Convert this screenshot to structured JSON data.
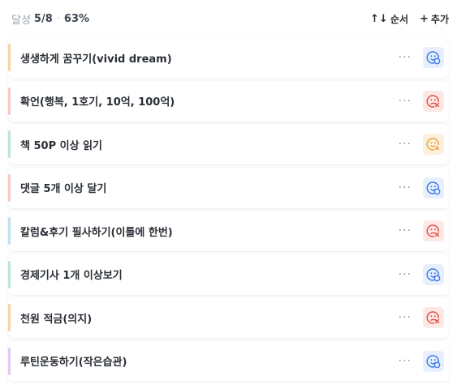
{
  "header": {
    "progress_label": "달성",
    "progress_count": "5/8",
    "progress_separator": "·",
    "progress_percent": "63%",
    "sort_icon": "↑↓",
    "sort_label": "순서",
    "add_icon": "+",
    "add_label": "추가"
  },
  "habits": [
    {
      "title": "생생하게 꿈꾸기(vivid dream)",
      "bar": "#f4d6a3",
      "status": "done",
      "more": "···"
    },
    {
      "title": "확언(행복, 1호기, 10억, 100억)",
      "bar": "#f6c9c3",
      "status": "failed",
      "more": "···"
    },
    {
      "title": "책 50P 이상 읽기",
      "bar": "#bfe3e0",
      "status": "partial",
      "more": "···"
    },
    {
      "title": "댓글 5개 이상 달기",
      "bar": "#f6c9c3",
      "status": "done",
      "more": "···"
    },
    {
      "title": "칼럼&후기 필사하기(이틀에 한번)",
      "bar": "#c3dff0",
      "status": "failed",
      "more": "···"
    },
    {
      "title": "경제기사 1개 이상보기",
      "bar": "#bfe3e0",
      "status": "done",
      "more": "···"
    },
    {
      "title": "천원 적금(의지)",
      "bar": "#f4d6a3",
      "status": "failed",
      "more": "···"
    },
    {
      "title": "루틴운동하기(작은습관)",
      "bar": "#e3c9f0",
      "status": "done",
      "more": "···"
    }
  ],
  "status_styles": {
    "done": {
      "bg": "#e7effd",
      "fg": "#3f7be6",
      "icon": "smile-check-icon"
    },
    "failed": {
      "bg": "#fde8e6",
      "fg": "#e2534a",
      "icon": "sad-x-icon"
    },
    "partial": {
      "bg": "#fdf0de",
      "fg": "#f0a23b",
      "icon": "neutral-triangle-icon"
    }
  }
}
